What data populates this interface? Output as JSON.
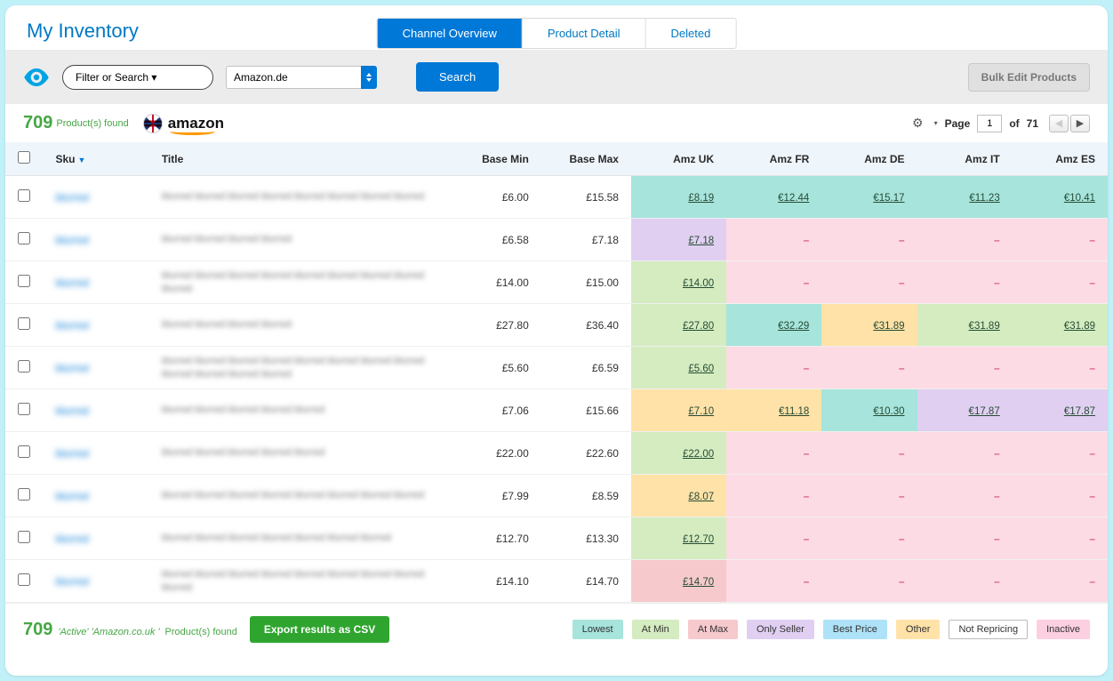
{
  "header": {
    "title": "My Inventory",
    "tabs": [
      {
        "id": "channel-overview",
        "label": "Channel Overview",
        "active": true
      },
      {
        "id": "product-detail",
        "label": "Product Detail",
        "active": false
      },
      {
        "id": "deleted",
        "label": "Deleted",
        "active": false
      }
    ]
  },
  "toolbar": {
    "filter_label": "Filter or Search ▾",
    "channel_selected": "Amazon.de",
    "search_label": "Search",
    "bulk_label": "Bulk Edit Products"
  },
  "status": {
    "count": "709",
    "count_label": "Product(s) found",
    "marketplace_logo_text": "amazon",
    "marketplace_flag": "uk"
  },
  "pager": {
    "page_label": "Page",
    "page": "1",
    "of_label": "of",
    "total_pages": "71",
    "prev_enabled": false,
    "next_enabled": true
  },
  "columns": {
    "sku": "Sku",
    "title": "Title",
    "base_min": "Base Min",
    "base_max": "Base Max",
    "amz_uk": "Amz UK",
    "amz_fr": "Amz FR",
    "amz_de": "Amz DE",
    "amz_it": "Amz IT",
    "amz_es": "Amz ES"
  },
  "rows": [
    {
      "sku": "blurred",
      "title": "blurred blurred blurred blurred blurred blurred blurred blurred",
      "base_min": "£6.00",
      "base_max": "£15.58",
      "cells": [
        {
          "v": "£8.19",
          "cls": "bg-lowest"
        },
        {
          "v": "€12.44",
          "cls": "bg-lowest"
        },
        {
          "v": "€15.17",
          "cls": "bg-lowest"
        },
        {
          "v": "€11.23",
          "cls": "bg-lowest"
        },
        {
          "v": "€10.41",
          "cls": "bg-lowest"
        }
      ]
    },
    {
      "sku": "blurred",
      "title": "blurred blurred blurred blurred",
      "base_min": "£6.58",
      "base_max": "£7.18",
      "cells": [
        {
          "v": "£7.18",
          "cls": "bg-onlyseller"
        },
        {
          "v": "–",
          "cls": "bg-pink"
        },
        {
          "v": "–",
          "cls": "bg-pink"
        },
        {
          "v": "–",
          "cls": "bg-pink"
        },
        {
          "v": "–",
          "cls": "bg-pink"
        }
      ]
    },
    {
      "sku": "blurred",
      "title": "blurred blurred blurred blurred blurred blurred blurred blurred blurred",
      "base_min": "£14.00",
      "base_max": "£15.00",
      "cells": [
        {
          "v": "£14.00",
          "cls": "bg-atmin"
        },
        {
          "v": "–",
          "cls": "bg-pink"
        },
        {
          "v": "–",
          "cls": "bg-pink"
        },
        {
          "v": "–",
          "cls": "bg-pink"
        },
        {
          "v": "–",
          "cls": "bg-pink"
        }
      ]
    },
    {
      "sku": "blurred",
      "title": "blurred blurred blurred blurred",
      "base_min": "£27.80",
      "base_max": "£36.40",
      "cells": [
        {
          "v": "£27.80",
          "cls": "bg-atmin"
        },
        {
          "v": "€32.29",
          "cls": "bg-lowest"
        },
        {
          "v": "€31.89",
          "cls": "bg-other"
        },
        {
          "v": "€31.89",
          "cls": "bg-atmin"
        },
        {
          "v": "€31.89",
          "cls": "bg-atmin"
        }
      ]
    },
    {
      "sku": "blurred",
      "title": "blurred blurred blurred blurred blurred blurred blurred blurred blurred blurred blurred blurred",
      "base_min": "£5.60",
      "base_max": "£6.59",
      "cells": [
        {
          "v": "£5.60",
          "cls": "bg-atmin"
        },
        {
          "v": "–",
          "cls": "bg-pink"
        },
        {
          "v": "–",
          "cls": "bg-pink"
        },
        {
          "v": "–",
          "cls": "bg-pink"
        },
        {
          "v": "–",
          "cls": "bg-pink"
        }
      ]
    },
    {
      "sku": "blurred",
      "title": "blurred blurred blurred blurred blurred",
      "base_min": "£7.06",
      "base_max": "£15.66",
      "cells": [
        {
          "v": "£7.10",
          "cls": "bg-other"
        },
        {
          "v": "€11.18",
          "cls": "bg-other"
        },
        {
          "v": "€10.30",
          "cls": "bg-lowest"
        },
        {
          "v": "€17.87",
          "cls": "bg-onlyseller"
        },
        {
          "v": "€17.87",
          "cls": "bg-onlyseller"
        }
      ]
    },
    {
      "sku": "blurred",
      "title": "blurred blurred blurred blurred blurred",
      "base_min": "£22.00",
      "base_max": "£22.60",
      "cells": [
        {
          "v": "£22.00",
          "cls": "bg-atmin"
        },
        {
          "v": "–",
          "cls": "bg-pink"
        },
        {
          "v": "–",
          "cls": "bg-pink"
        },
        {
          "v": "–",
          "cls": "bg-pink"
        },
        {
          "v": "–",
          "cls": "bg-pink"
        }
      ]
    },
    {
      "sku": "blurred",
      "title": "blurred blurred blurred blurred blurred blurred blurred blurred",
      "base_min": "£7.99",
      "base_max": "£8.59",
      "cells": [
        {
          "v": "£8.07",
          "cls": "bg-other"
        },
        {
          "v": "–",
          "cls": "bg-pink"
        },
        {
          "v": "–",
          "cls": "bg-pink"
        },
        {
          "v": "–",
          "cls": "bg-pink"
        },
        {
          "v": "–",
          "cls": "bg-pink"
        }
      ]
    },
    {
      "sku": "blurred",
      "title": "blurred blurred blurred blurred blurred blurred blurred",
      "base_min": "£12.70",
      "base_max": "£13.30",
      "cells": [
        {
          "v": "£12.70",
          "cls": "bg-atmin"
        },
        {
          "v": "–",
          "cls": "bg-pink"
        },
        {
          "v": "–",
          "cls": "bg-pink"
        },
        {
          "v": "–",
          "cls": "bg-pink"
        },
        {
          "v": "–",
          "cls": "bg-pink"
        }
      ]
    },
    {
      "sku": "blurred",
      "title": "blurred blurred blurred blurred blurred blurred blurred blurred blurred",
      "base_min": "£14.10",
      "base_max": "£14.70",
      "cells": [
        {
          "v": "£14.70",
          "cls": "bg-atmax"
        },
        {
          "v": "–",
          "cls": "bg-pink"
        },
        {
          "v": "–",
          "cls": "bg-pink"
        },
        {
          "v": "–",
          "cls": "bg-pink"
        },
        {
          "v": "–",
          "cls": "bg-pink"
        }
      ]
    }
  ],
  "footer": {
    "count": "709",
    "count_label_prefix": "'Active' 'Amazon.co.uk '",
    "count_label_suffix": "Product(s) found",
    "export_label": "Export results as CSV"
  },
  "legend": {
    "lowest": "Lowest",
    "atmin": "At Min",
    "atmax": "At Max",
    "onlyseller": "Only Seller",
    "bestprice": "Best Price",
    "other": "Other",
    "norep": "Not Repricing",
    "inactive": "Inactive"
  },
  "dash": "–"
}
